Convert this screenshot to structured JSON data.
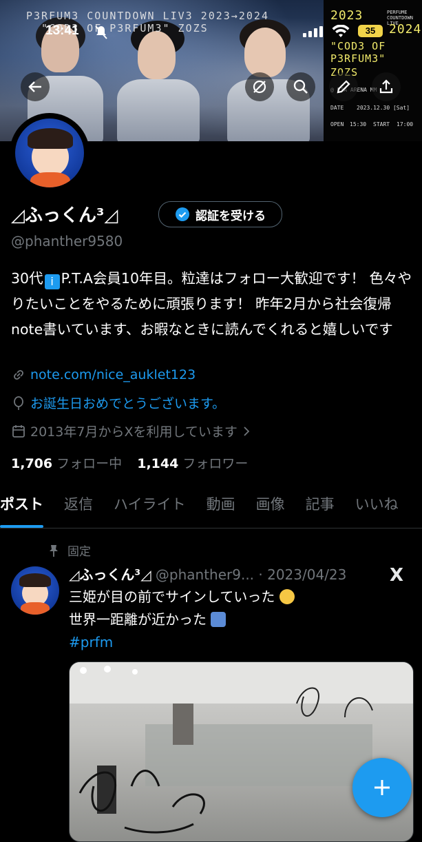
{
  "status_bar": {
    "time": "13:41",
    "battery": "35"
  },
  "banner": {
    "title_line1": "P3RFUM3 COUNTDOWN LIV3 2023→2024",
    "title_line2": "\"COD3 OF P3RFUM3\" ZOZS",
    "poster": {
      "year1": "2023",
      "year2": "2024",
      "code": "\"COD3 OF",
      "code2": "P3RFUM3\"",
      "zozs": "ZOZS",
      "small": "PERFUME COUNTDOWN LIVE",
      "venue": "@ PIA ARENA MM",
      "date_label": "DATE",
      "date_value": "2023.12.30 [Sat]",
      "open_label": "OPEN",
      "open_value": "15:30",
      "start_label": "START",
      "start_value": "17:00"
    }
  },
  "profile": {
    "display_name": "◿ふっくん³◿",
    "verify_button": "認証を受ける",
    "handle": "@phanther9580",
    "bio_pre": "30代",
    "bio_post": "P.T.A会員10年目。粒達はフォロー大歓迎です！ 色々やりたいことをやるために頑張ります！ 昨年2月から社会復帰 note書いています、お暇なときに読んでくれると嬉しいです",
    "link": "note.com/nice_auklet123",
    "birthday": "お誕生日おめでとうございます。",
    "joined": "2013年7月からXを利用しています",
    "following_count": "1,706",
    "following_label": "フォロー中",
    "followers_count": "1,144",
    "followers_label": "フォロワー"
  },
  "tabs": [
    "ポスト",
    "返信",
    "ハイライト",
    "動画",
    "画像",
    "記事",
    "いいね"
  ],
  "pinned_post": {
    "pinned_label": "固定",
    "author": "◿ふっくん³◿",
    "handle_date": "@phanther9... · 2023/04/23",
    "line1": "三姫が目の前でサインしていった",
    "line2": "世界一距離が近かった",
    "hashtag": "#prfm"
  },
  "colors": {
    "accent": "#1d9bf0",
    "background": "#000000",
    "muted": "#71767b",
    "battery": "#f1d44a"
  }
}
